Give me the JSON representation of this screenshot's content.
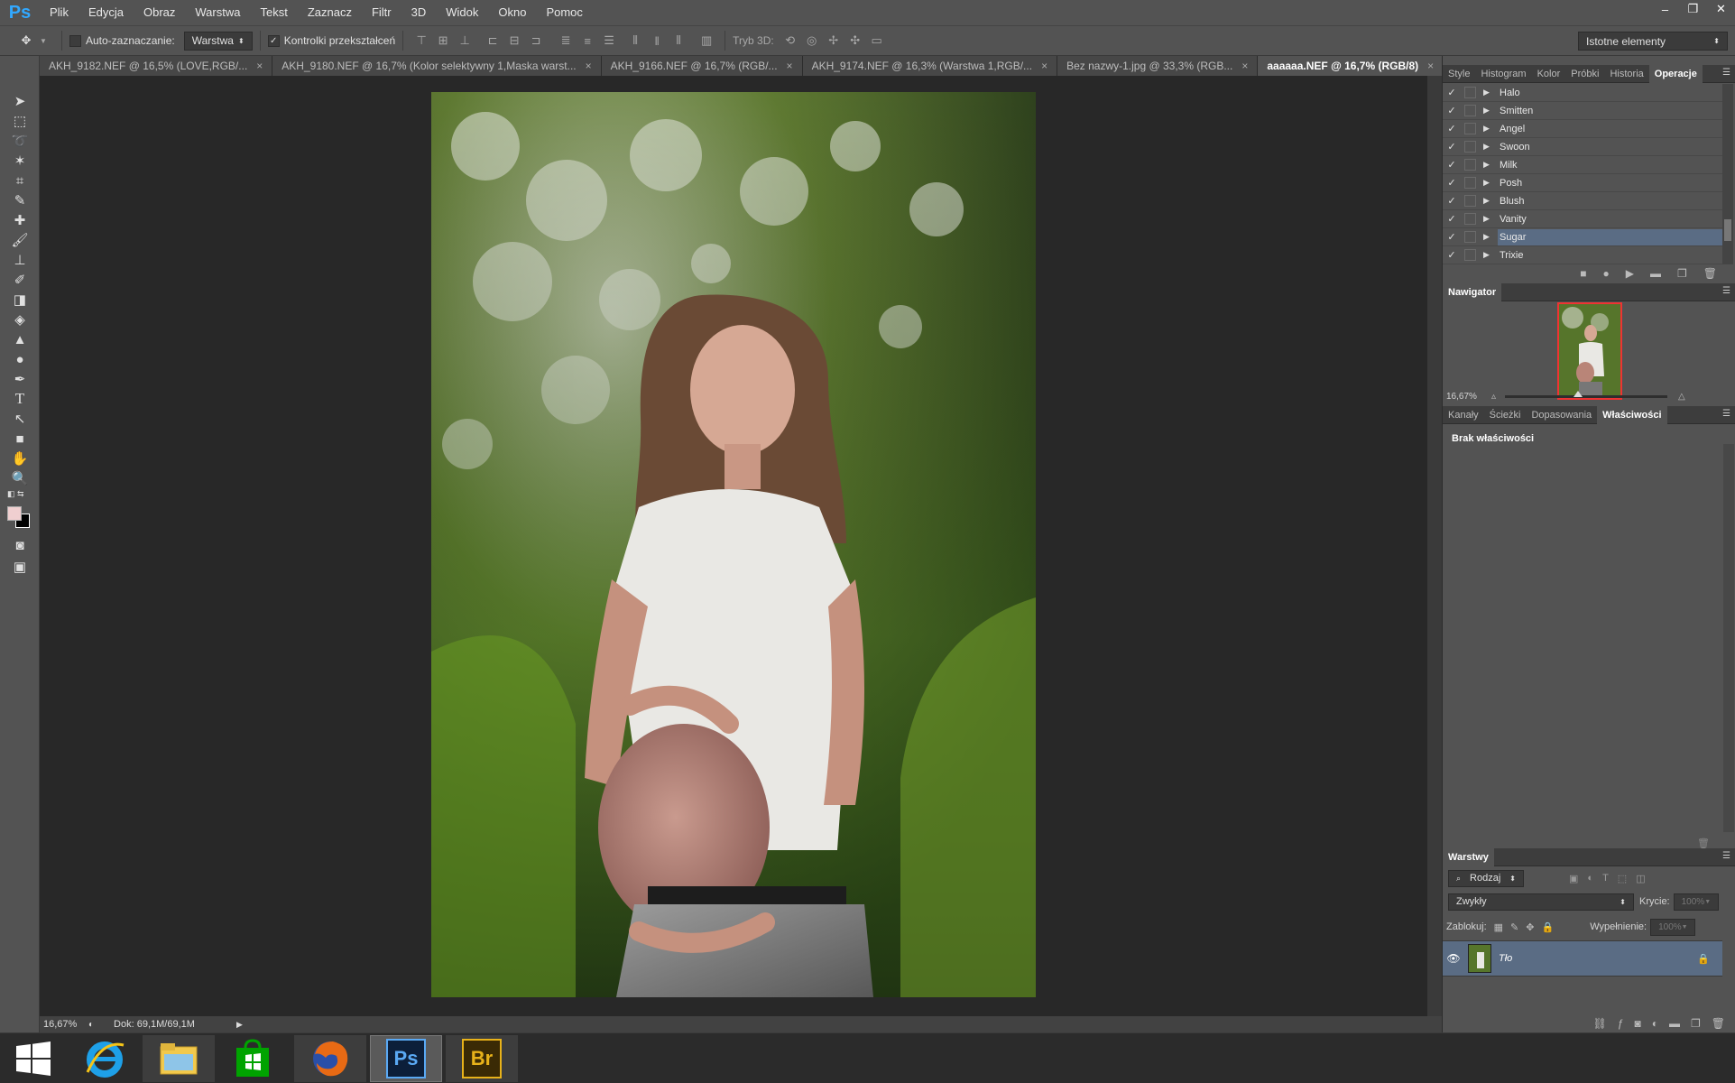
{
  "menubar": {
    "logo": "Ps",
    "items": [
      "Plik",
      "Edycja",
      "Obraz",
      "Warstwa",
      "Tekst",
      "Zaznacz",
      "Filtr",
      "3D",
      "Widok",
      "Okno",
      "Pomoc"
    ]
  },
  "window_controls": {
    "minimize": "–",
    "restore": "❐",
    "close": "✕"
  },
  "options": {
    "auto_select_label": "Auto-zaznaczanie:",
    "auto_select_value": "Warstwa",
    "transform_label": "Kontrolki przekształceń",
    "mode3d_label": "Tryb 3D:",
    "workspace": "Istotne elementy"
  },
  "tabs": [
    {
      "label": "AKH_9182.NEF @ 16,5% (LOVE,RGB/...",
      "close": "×"
    },
    {
      "label": "AKH_9180.NEF @ 16,7% (Kolor selektywny 1,Maska warst...",
      "close": "×"
    },
    {
      "label": "AKH_9166.NEF @ 16,7% (RGB/...",
      "close": "×"
    },
    {
      "label": "AKH_9174.NEF @ 16,3% (Warstwa 1,RGB/...",
      "close": "×"
    },
    {
      "label": "Bez nazwy-1.jpg @ 33,3% (RGB...",
      "close": "×"
    },
    {
      "label": "aaaaaa.NEF @ 16,7% (RGB/8)",
      "close": "×"
    }
  ],
  "status": {
    "zoom": "16,67%",
    "doc": "Dok: 69,1M/69,1M"
  },
  "actions_panel": {
    "tabs": [
      "Style",
      "Histogram",
      "Kolor",
      "Próbki",
      "Historia",
      "Operacje"
    ],
    "active": "Operacje",
    "items": [
      "Halo",
      "Smitten",
      "Angel",
      "Swoon",
      "Milk",
      "Posh",
      "Blush",
      "Vanity",
      "Sugar",
      "Trixie"
    ],
    "selected": "Sugar"
  },
  "navigator": {
    "title": "Nawigator",
    "zoom": "16,67%",
    "zoom_fraction": 0.45
  },
  "properties": {
    "tabs": [
      "Kanały",
      "Ścieżki",
      "Dopasowania",
      "Właściwości"
    ],
    "active": "Właściwości",
    "message": "Brak właściwości"
  },
  "layers": {
    "title": "Warstwy",
    "filter_kind": "Rodzaj",
    "blend": "Zwykły",
    "opacity_label": "Krycie:",
    "opacity": "100%",
    "lock_label": "Zablokuj:",
    "fill_label": "Wypełnienie:",
    "fill": "100%",
    "layer_name": "Tło"
  },
  "colors": {
    "accent": "#31a8ff",
    "selected_row": "#5a6c84",
    "fg_swatch": "#f0cfd0",
    "bg_swatch": "#000000"
  }
}
